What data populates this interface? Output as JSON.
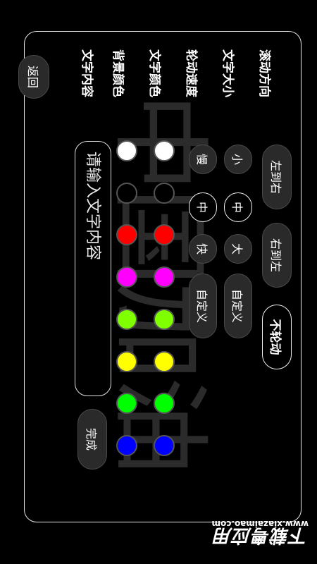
{
  "marquee_text": "中国加油",
  "back_button": "返回",
  "rows": {
    "scroll_direction": {
      "label": "滚动方向",
      "options": [
        "左到右",
        "右到左",
        "不轮动"
      ],
      "selected_index": 2
    },
    "font_size": {
      "label": "文字大小",
      "options": [
        "小",
        "中",
        "大",
        "自定义"
      ],
      "selected_index": 1
    },
    "scroll_speed": {
      "label": "轮动速度",
      "options": [
        "慢",
        "中",
        "快",
        "自定义"
      ],
      "selected_index": 1
    },
    "text_color": {
      "label": "文字颜色",
      "swatches": [
        "#ffffff",
        "#000000",
        "#ff0000",
        "#ff00ff",
        "#7fff00",
        "#ffff00",
        "#00ff00",
        "#0000ff"
      ]
    },
    "background_color": {
      "label": "背景颜色",
      "swatches": [
        "#ffffff",
        "#000000",
        "#ff0000",
        "#ff00ff",
        "#7fff00",
        "#ffff00",
        "#00ff00",
        "#0000ff"
      ]
    },
    "text_content": {
      "label": "文字内容",
      "placeholder": "请输入文字内容",
      "value": ""
    }
  },
  "done_button": "完成",
  "site_watermark": {
    "title": "下载粤应用",
    "url": "www.xiazaimao.com"
  }
}
